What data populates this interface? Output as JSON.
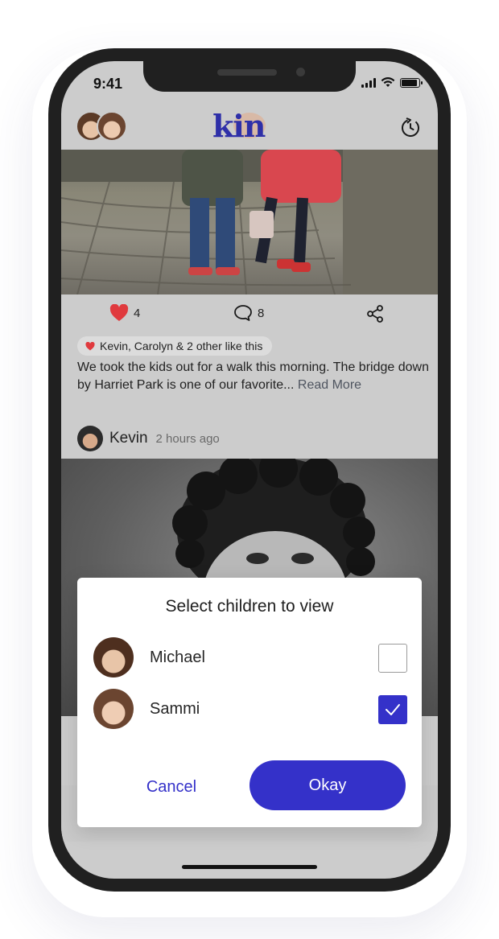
{
  "status_bar": {
    "time": "9:41",
    "battery_level": 0.9
  },
  "header": {
    "logo_text": "kin"
  },
  "post": {
    "likes_count": "4",
    "comments_count": "8",
    "liked_by": "Kevin, Carolyn & 2 other like this",
    "caption": "We took the kids out for a walk this morning. The bridge down by Harriet Park is one of our favorite...",
    "read_more": "Read More"
  },
  "next_post": {
    "author": "Kevin",
    "time": "2 hours ago"
  },
  "dialog": {
    "title": "Select children to view",
    "children": [
      {
        "name": "Michael",
        "checked": false
      },
      {
        "name": "Sammi",
        "checked": true
      }
    ],
    "cancel_label": "Cancel",
    "okay_label": "Okay"
  },
  "colors": {
    "accent": "#3431c9",
    "logo": "#2e2fa8",
    "heart": "#e03a3e",
    "logo_blob": "#d8b9a6"
  },
  "icons": [
    "heart-icon",
    "comment-icon",
    "share-icon",
    "history-icon",
    "check-icon",
    "signal-icon",
    "wifi-icon",
    "battery-icon"
  ]
}
